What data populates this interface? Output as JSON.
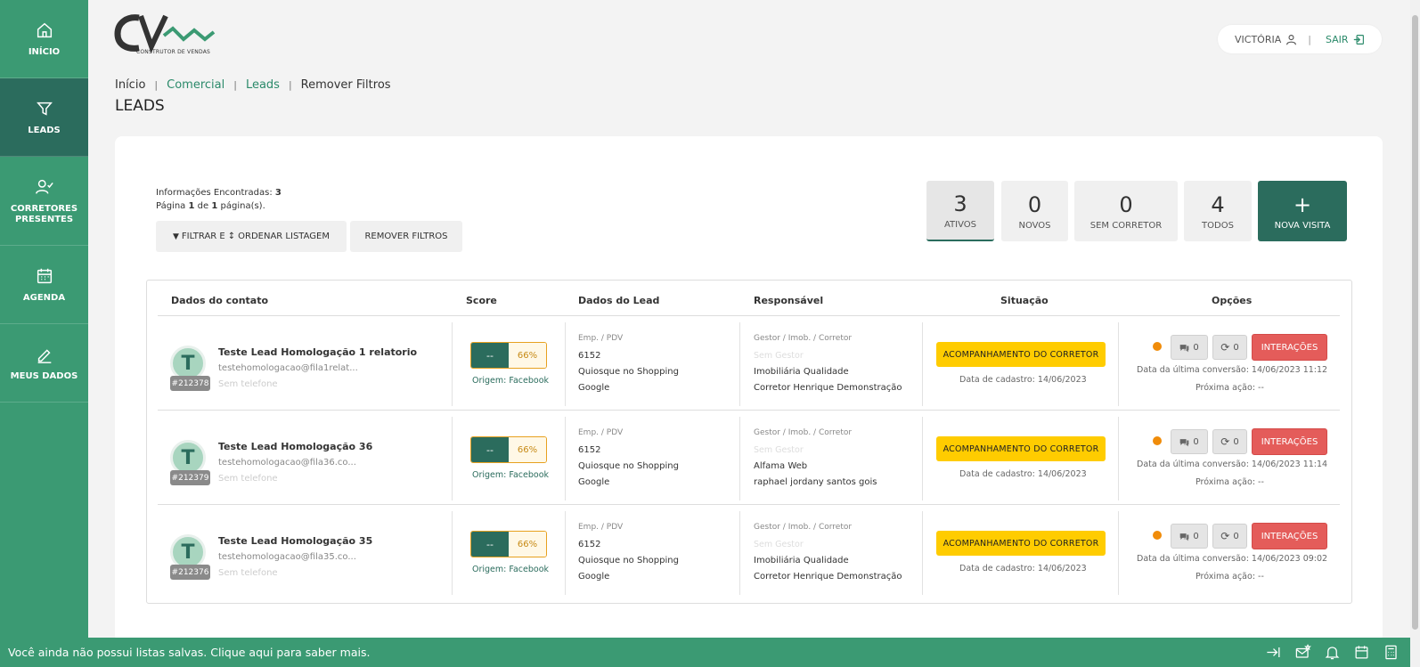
{
  "sidebar": {
    "items": [
      {
        "label": "INÍCIO"
      },
      {
        "label": "LEADS"
      },
      {
        "label": "CORRETORES PRESENTES"
      },
      {
        "label": "AGENDA"
      },
      {
        "label": "MEUS DADOS"
      }
    ]
  },
  "logo": {
    "subtitle": "CONSTRUTOR DE VENDAS"
  },
  "user": {
    "name": "VICTÓRIA",
    "separator": "|",
    "logout": "SAIR"
  },
  "breadcrumb": {
    "items": [
      "Início",
      "Comercial",
      "Leads",
      "Remover Filtros"
    ],
    "sep": "|"
  },
  "page_title": "LEADS",
  "info": {
    "found_label": "Informações Encontradas:",
    "found_value": "3",
    "page_prefix": "Página",
    "page_current": "1",
    "page_of": "de",
    "page_total": "1",
    "page_suffix": "página(s)."
  },
  "filters": {
    "filter_a": "FILTRAR E",
    "filter_b": "ORDENAR LISTAGEM",
    "remove": "REMOVER FILTROS"
  },
  "stats": [
    {
      "num": "3",
      "label": "ATIVOS"
    },
    {
      "num": "0",
      "label": "NOVOS"
    },
    {
      "num": "0",
      "label": "SEM CORRETOR"
    },
    {
      "num": "4",
      "label": "TODOS"
    },
    {
      "num": "+",
      "label": "NOVA VISITA"
    }
  ],
  "table": {
    "headers": [
      "Dados do contato",
      "Score",
      "Dados do Lead",
      "Responsável",
      "Situação",
      "Opções"
    ],
    "rows": [
      {
        "initial": "T",
        "id": "#212378",
        "name": "Teste Lead Homologação 1 relatorio",
        "email": "testehomologacao@fila1relat...",
        "phone": "Sem telefone",
        "score_left": "--",
        "score_right": "66%",
        "origem": "Origem: Facebook",
        "emp_label": "Emp. / PDV",
        "emp_code": "6152",
        "emp_name": "Quiosque no Shopping",
        "emp_source": "Google",
        "resp_label": "Gestor / Imob. / Corretor",
        "resp_gestor": "Sem Gestor",
        "resp_imob": "Imobiliária Qualidade",
        "resp_corretor": "Corretor Henrique Demonstração",
        "status": "ACOMPANHAMENTO DO CORRETOR",
        "cadastro": "Data de cadastro: 14/06/2023",
        "msg_count": "0",
        "sync_count": "0",
        "interacoes": "INTERAÇÕES",
        "last_conv": "Data da última conversão: 14/06/2023 11:12",
        "next_action": "Próxima ação: --"
      },
      {
        "initial": "T",
        "id": "#212379",
        "name": "Teste Lead Homologação 36",
        "email": "testehomologacao@fila36.co...",
        "phone": "Sem telefone",
        "score_left": "--",
        "score_right": "66%",
        "origem": "Origem: Facebook",
        "emp_label": "Emp. / PDV",
        "emp_code": "6152",
        "emp_name": "Quiosque no Shopping",
        "emp_source": "Google",
        "resp_label": "Gestor / Imob. / Corretor",
        "resp_gestor": "Sem Gestor",
        "resp_imob": "Alfama Web",
        "resp_corretor": "raphael jordany santos gois",
        "status": "ACOMPANHAMENTO DO CORRETOR",
        "cadastro": "Data de cadastro: 14/06/2023",
        "msg_count": "0",
        "sync_count": "0",
        "interacoes": "INTERAÇÕES",
        "last_conv": "Data da última conversão: 14/06/2023 11:14",
        "next_action": "Próxima ação: --"
      },
      {
        "initial": "T",
        "id": "#212376",
        "name": "Teste Lead Homologação 35",
        "email": "testehomologacao@fila35.co...",
        "phone": "Sem telefone",
        "score_left": "--",
        "score_right": "66%",
        "origem": "Origem: Facebook",
        "emp_label": "Emp. / PDV",
        "emp_code": "6152",
        "emp_name": "Quiosque no Shopping",
        "emp_source": "Google",
        "resp_label": "Gestor / Imob. / Corretor",
        "resp_gestor": "Sem Gestor",
        "resp_imob": "Imobiliária Qualidade",
        "resp_corretor": "Corretor Henrique Demonstração",
        "status": "ACOMPANHAMENTO DO CORRETOR",
        "cadastro": "Data de cadastro: 14/06/2023",
        "msg_count": "0",
        "sync_count": "0",
        "interacoes": "INTERAÇÕES",
        "last_conv": "Data da última conversão: 14/06/2023 09:02",
        "next_action": "Próxima ação: --"
      }
    ]
  },
  "bottom_bar": {
    "message": "Você ainda não possui listas salvas. Clique aqui para saber mais."
  },
  "colors": {
    "sidebar": "#3b9a73",
    "sidebar_active": "#2b6c5d",
    "status_yellow": "#ffcc00",
    "danger": "#e45c5a",
    "dot_orange": "#f08c0a"
  }
}
